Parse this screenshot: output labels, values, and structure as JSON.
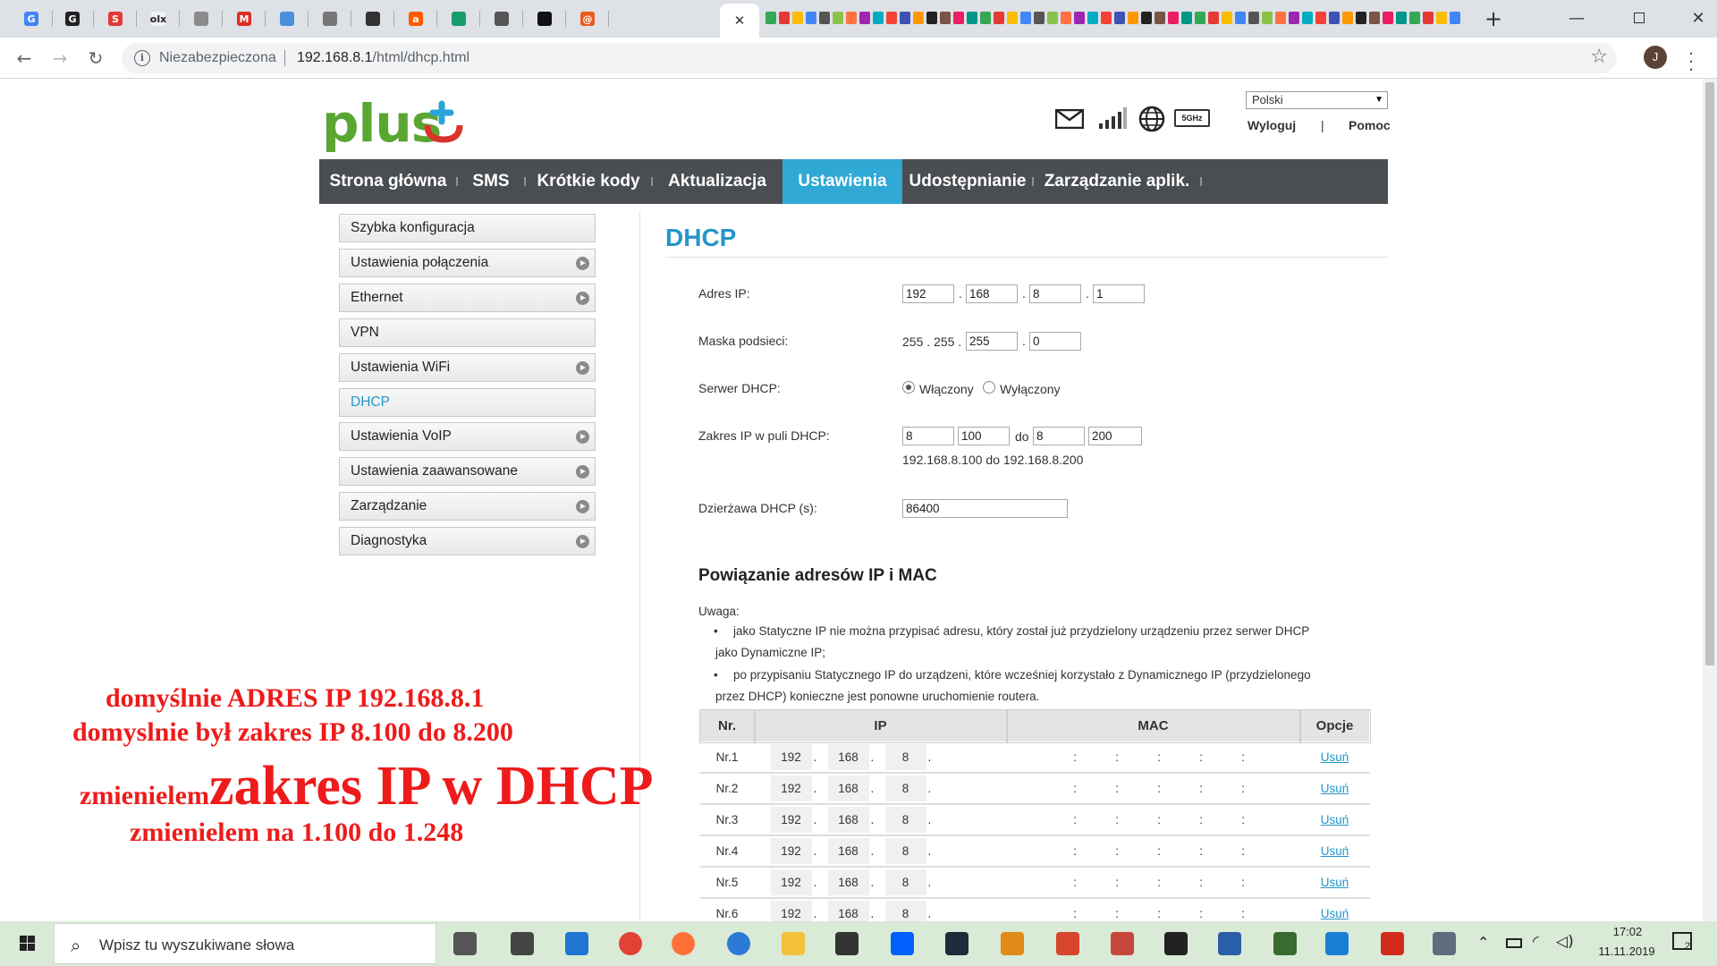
{
  "browser": {
    "tabs_left": [
      {
        "icon": "google-icon",
        "glyph": "G",
        "color": "#4285f4"
      },
      {
        "icon": "g-square-icon",
        "glyph": "G",
        "color": "#222"
      },
      {
        "icon": "s-circle-icon",
        "glyph": "S",
        "color": "#e53935"
      },
      {
        "icon": "olx-icon",
        "glyph": "olx",
        "color": "#f2f2f2"
      },
      {
        "icon": "arrow-doc-icon",
        "glyph": "",
        "color": "#8b8b8b"
      },
      {
        "icon": "gmail-icon",
        "glyph": "M",
        "color": "#d93025"
      },
      {
        "icon": "cube-icon",
        "glyph": "",
        "color": "#4a90d9"
      },
      {
        "icon": "box-icon",
        "glyph": "",
        "color": "#777"
      },
      {
        "icon": "box-dark-icon",
        "glyph": "",
        "color": "#333"
      },
      {
        "icon": "allegro-icon",
        "glyph": "a",
        "color": "#ff5a00"
      },
      {
        "icon": "wave-icon",
        "glyph": "",
        "color": "#1a9b6b"
      },
      {
        "icon": "globe-dark-icon",
        "glyph": "",
        "color": "#555"
      },
      {
        "icon": "circle-dark-icon",
        "glyph": "",
        "color": "#111"
      },
      {
        "icon": "at-icon",
        "glyph": "@",
        "color": "#e85b21"
      }
    ],
    "close_tab_glyph": "✕",
    "new_tab_glyph": "+",
    "address_insecure": "Niezabezpieczona",
    "url_host": "192.168.8.1",
    "url_path": "/html/dhcp.html",
    "profile_initial": "J"
  },
  "header": {
    "logo_text": "plus",
    "language": "Polski",
    "logout": "Wyloguj",
    "separator": "|",
    "help": "Pomoc",
    "icons": [
      "mail-icon",
      "signal-icon",
      "globe-icon",
      "wifi-5ghz-icon"
    ],
    "wifi_band": "5GHz"
  },
  "nav": [
    {
      "label": "Strona główna",
      "active": false
    },
    {
      "label": "SMS",
      "active": false
    },
    {
      "label": "Krótkie kody",
      "active": false
    },
    {
      "label": "Aktualizacja",
      "active": false
    },
    {
      "label": "Ustawienia",
      "active": true
    },
    {
      "label": "Udostępnianie",
      "active": false
    },
    {
      "label": "Zarządzanie aplik.",
      "active": false
    }
  ],
  "sidebar": [
    {
      "label": "Szybka konfiguracja",
      "chevron": false,
      "active": false
    },
    {
      "label": "Ustawienia połączenia",
      "chevron": true,
      "active": false
    },
    {
      "label": "Ethernet",
      "chevron": true,
      "active": false
    },
    {
      "label": "VPN",
      "chevron": false,
      "active": false
    },
    {
      "label": "Ustawienia WiFi",
      "chevron": true,
      "active": false
    },
    {
      "label": "DHCP",
      "chevron": false,
      "active": true
    },
    {
      "label": "Ustawienia VoIP",
      "chevron": true,
      "active": false
    },
    {
      "label": "Ustawienia zaawansowane",
      "chevron": true,
      "active": false
    },
    {
      "label": "Zarządzanie",
      "chevron": true,
      "active": false
    },
    {
      "label": "Diagnostyka",
      "chevron": true,
      "active": false
    }
  ],
  "dhcp": {
    "title": "DHCP",
    "ip_label": "Adres IP:",
    "ip": [
      "192",
      "168",
      "8",
      "1"
    ],
    "mask_label": "Maska podsieci:",
    "mask_fixed": "255 . 255 .",
    "mask": [
      "255",
      "0"
    ],
    "server_label": "Serwer DHCP:",
    "server_on": "Włączony",
    "server_off": "Wyłączony",
    "server_enabled": true,
    "range_label": "Zakres IP w puli DHCP:",
    "range_start": [
      "8",
      "100"
    ],
    "range_to": "do",
    "range_end": [
      "8",
      "200"
    ],
    "range_summary": "192.168.8.100 do 192.168.8.200",
    "lease_label": "Dzierżawa DHCP (s):",
    "lease": "86400"
  },
  "binding": {
    "title": "Powiązanie adresów IP i MAC",
    "note_label": "Uwaga:",
    "notes": [
      [
        "jako Statyczne IP nie można przypisać adresu, który został już przydzielony urządzeniu przez serwer DHCP",
        "jako Dynamiczne IP;"
      ],
      [
        "po przypisaniu Statycznego IP do urządzeni, które wcześniej korzystało z Dynamicznego IP (przydzielonego",
        "przez DHCP) konieczne jest ponowne uruchomienie routera."
      ]
    ],
    "headers": [
      "Nr.",
      "IP",
      "MAC",
      "Opcje"
    ],
    "rows": [
      {
        "nr": "Nr.1",
        "ip": [
          "192",
          "168",
          "8"
        ],
        "action": "Usuń"
      },
      {
        "nr": "Nr.2",
        "ip": [
          "192",
          "168",
          "8"
        ],
        "action": "Usuń"
      },
      {
        "nr": "Nr.3",
        "ip": [
          "192",
          "168",
          "8"
        ],
        "action": "Usuń"
      },
      {
        "nr": "Nr.4",
        "ip": [
          "192",
          "168",
          "8"
        ],
        "action": "Usuń"
      },
      {
        "nr": "Nr.5",
        "ip": [
          "192",
          "168",
          "8"
        ],
        "action": "Usuń"
      },
      {
        "nr": "Nr.6",
        "ip": [
          "192",
          "168",
          "8"
        ],
        "action": "Usuń"
      }
    ]
  },
  "annotations": {
    "line1": "domyślnie ADRES IP 192.168.8.1",
    "line2": "domyslnie był zakres IP 8.100 do 8.200",
    "line3_small": "zmienielem",
    "line3_big": "zakres IP w DHCP",
    "line4": "zmienielem na 1.100 do 1.248",
    "color": "#ee1b1b"
  },
  "taskbar": {
    "search_placeholder": "Wpisz tu wyszukiwane słowa",
    "apps": [
      {
        "name": "task-view-icon",
        "color": "#555"
      },
      {
        "name": "calculator-icon",
        "color": "#444"
      },
      {
        "name": "edge-icon",
        "color": "#1f75d1"
      },
      {
        "name": "chrome-icon",
        "color": "#e24236"
      },
      {
        "name": "firefox-icon",
        "color": "#ff7139"
      },
      {
        "name": "thunderbird-icon",
        "color": "#2c7ad6"
      },
      {
        "name": "file-explorer-icon",
        "color": "#f3c13a"
      },
      {
        "name": "store-icon",
        "color": "#333"
      },
      {
        "name": "dropbox-icon",
        "color": "#0061fe"
      },
      {
        "name": "visual-studio-icon",
        "color": "#1f2a3a"
      },
      {
        "name": "app-orange-icon",
        "color": "#e28a18"
      },
      {
        "name": "app-eye-icon",
        "color": "#d6452c"
      },
      {
        "name": "app-swirl-icon",
        "color": "#c7473c"
      },
      {
        "name": "app-panda-icon",
        "color": "#222"
      },
      {
        "name": "app-window-icon",
        "color": "#2b5ea8"
      },
      {
        "name": "shift-n-icon",
        "color": "#3a6b2e"
      },
      {
        "name": "app-sync-icon",
        "color": "#1a7fd4"
      },
      {
        "name": "acrobat-icon",
        "color": "#d42a1e"
      },
      {
        "name": "app-network-icon",
        "color": "#5d6d7e"
      }
    ],
    "time": "17:02",
    "date": "11.11.2019",
    "notifications": "2"
  }
}
